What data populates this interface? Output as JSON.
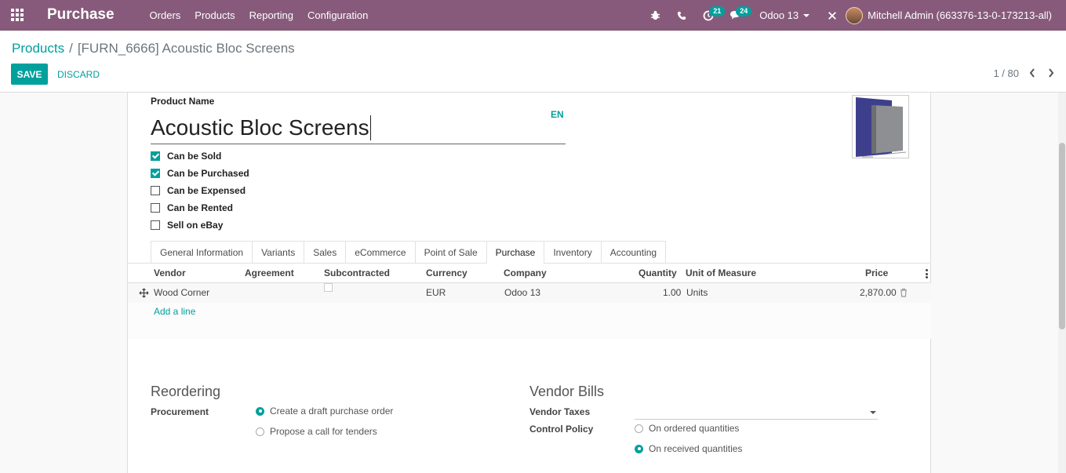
{
  "navbar": {
    "app_name": "Purchase",
    "menu": [
      "Orders",
      "Products",
      "Reporting",
      "Configuration"
    ],
    "activity_count": "21",
    "messages_count": "24",
    "company": "Odoo 13",
    "user": "Mitchell Admin (663376-13-0-173213-all)"
  },
  "control": {
    "breadcrumb_parent": "Products",
    "breadcrumb_sep": "/",
    "breadcrumb_current": "[FURN_6666] Acoustic Bloc Screens",
    "save_label": "SAVE",
    "discard_label": "DISCARD",
    "pager": "1 / 80"
  },
  "form": {
    "name_label": "Product Name",
    "name_value": "Acoustic Bloc Screens",
    "lang": "EN",
    "checks": [
      {
        "label": "Can be Sold",
        "checked": true
      },
      {
        "label": "Can be Purchased",
        "checked": true
      },
      {
        "label": "Can be Expensed",
        "checked": false
      },
      {
        "label": "Can be Rented",
        "checked": false
      },
      {
        "label": "Sell on eBay",
        "checked": false
      }
    ],
    "tabs": [
      "General Information",
      "Variants",
      "Sales",
      "eCommerce",
      "Point of Sale",
      "Purchase",
      "Inventory",
      "Accounting"
    ],
    "active_tab": "Purchase"
  },
  "vendor_table": {
    "columns": {
      "vendor": "Vendor",
      "agreement": "Agreement",
      "subcontracted": "Subcontracted",
      "currency": "Currency",
      "company": "Company",
      "quantity": "Quantity",
      "uom": "Unit of Measure",
      "price": "Price"
    },
    "rows": [
      {
        "vendor": "Wood Corner",
        "agreement": "",
        "currency": "EUR",
        "company": "Odoo 13",
        "quantity": "1.00",
        "uom": "Units",
        "price": "2,870.00"
      }
    ],
    "add_line": "Add a line"
  },
  "reordering": {
    "title": "Reordering",
    "procurement_label": "Procurement",
    "options": [
      "Create a draft purchase order",
      "Propose a call for tenders"
    ],
    "selected": 0
  },
  "vendor_bills": {
    "title": "Vendor Bills",
    "taxes_label": "Vendor Taxes",
    "control_label": "Control Policy",
    "options": [
      "On ordered quantities",
      "On received quantities"
    ],
    "selected": 1
  },
  "colors": {
    "brand": "#875a7b",
    "accent": "#00a09d"
  }
}
